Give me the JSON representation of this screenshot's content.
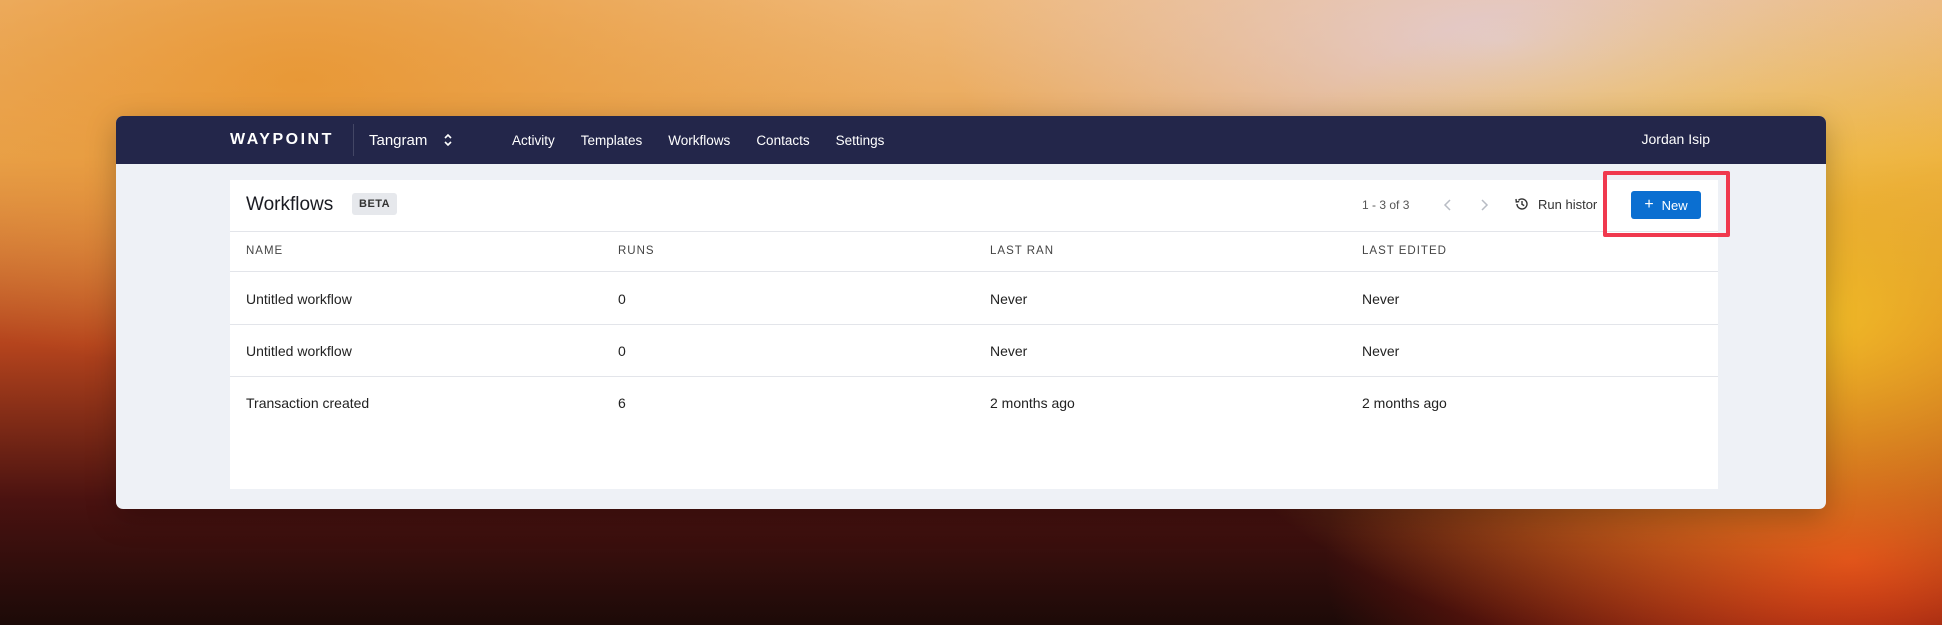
{
  "topbar": {
    "logo": "WAYPOINT",
    "org_name": "Tangram",
    "nav": [
      "Activity",
      "Templates",
      "Workflows",
      "Contacts",
      "Settings"
    ],
    "user_name": "Jordan Isip"
  },
  "header": {
    "title": "Workflows",
    "badge": "BETA",
    "pagination": "1 - 3 of 3",
    "run_history_label": "Run histor",
    "new_label": "New"
  },
  "table": {
    "columns": [
      "NAME",
      "RUNS",
      "LAST RAN",
      "LAST EDITED"
    ],
    "rows": [
      [
        "Untitled workflow",
        "0",
        "Never",
        "Never"
      ],
      [
        "Untitled workflow",
        "0",
        "Never",
        "Never"
      ],
      [
        "Transaction created",
        "6",
        "2 months ago",
        "2 months ago"
      ]
    ]
  },
  "colors": {
    "topbar": "#23264a",
    "accent": "#0b6fd1",
    "highlight": "#f0394e"
  }
}
